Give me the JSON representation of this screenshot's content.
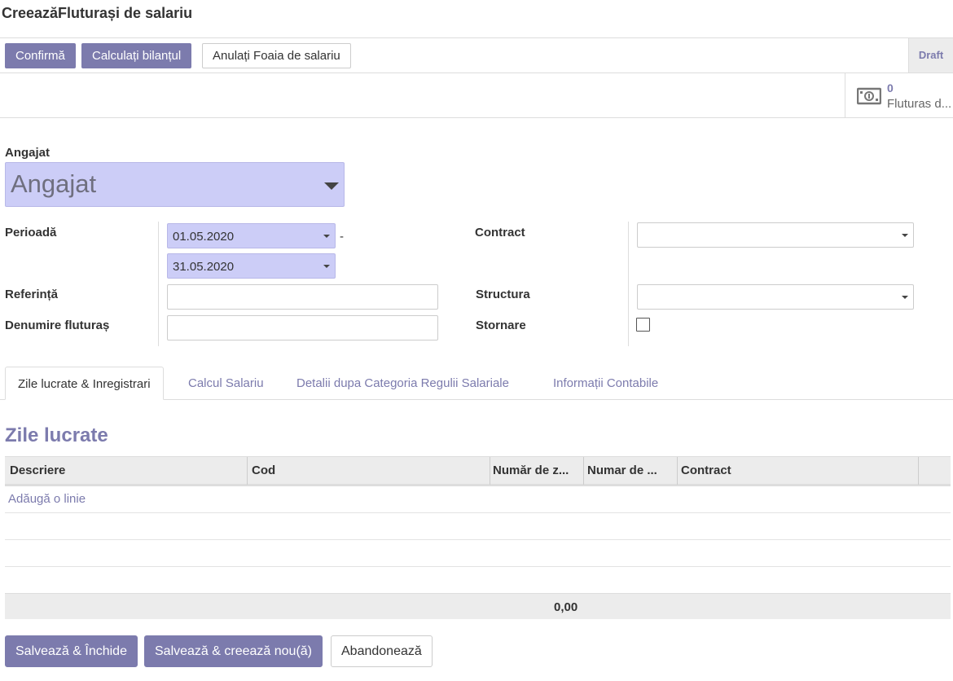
{
  "dialog": {
    "title": "CreeazăFluturași de salariu"
  },
  "statusbar": {
    "confirm_label": "Confirmă",
    "compute_label": "Calculați bilanțul",
    "cancel_label": "Anulați Foaia de salariu",
    "state": "Draft"
  },
  "smart_button": {
    "icon": "money-bill-icon",
    "count": "0",
    "label": "Fluturas d..."
  },
  "form": {
    "employee_label": "Angajat",
    "employee_placeholder": "Angajat",
    "period_label": "Perioadă",
    "date_from": "01.05.2020",
    "date_separator": "-",
    "date_to": "31.05.2020",
    "reference_label": "Referință",
    "reference_value": "",
    "payslip_name_label": "Denumire fluturaș",
    "payslip_name_value": "",
    "contract_label": "Contract",
    "contract_value": "",
    "structure_label": "Structura",
    "structure_value": "",
    "reversal_label": "Stornare",
    "reversal_checked": false
  },
  "tabs": [
    {
      "label": "Zile lucrate & Inregistrari",
      "active": true
    },
    {
      "label": "Calcul Salariu",
      "active": false
    },
    {
      "label": "Detalii dupa Categoria Regulii Salariale",
      "active": false
    },
    {
      "label": "Informații Contabile",
      "active": false
    }
  ],
  "worked_days": {
    "title": "Zile lucrate",
    "columns": [
      "Descriere",
      "Cod",
      "Număr de z...",
      "Numar de ...",
      "Contract"
    ],
    "add_line": "Adăugă o linie",
    "total": "0,00"
  },
  "footer": {
    "save_close": "Salvează & Închide",
    "save_new": "Salvează & creează nou(ă)",
    "discard": "Abandonează"
  },
  "colors": {
    "primary": "#7c7bad",
    "required_field": "#cccdf7"
  }
}
